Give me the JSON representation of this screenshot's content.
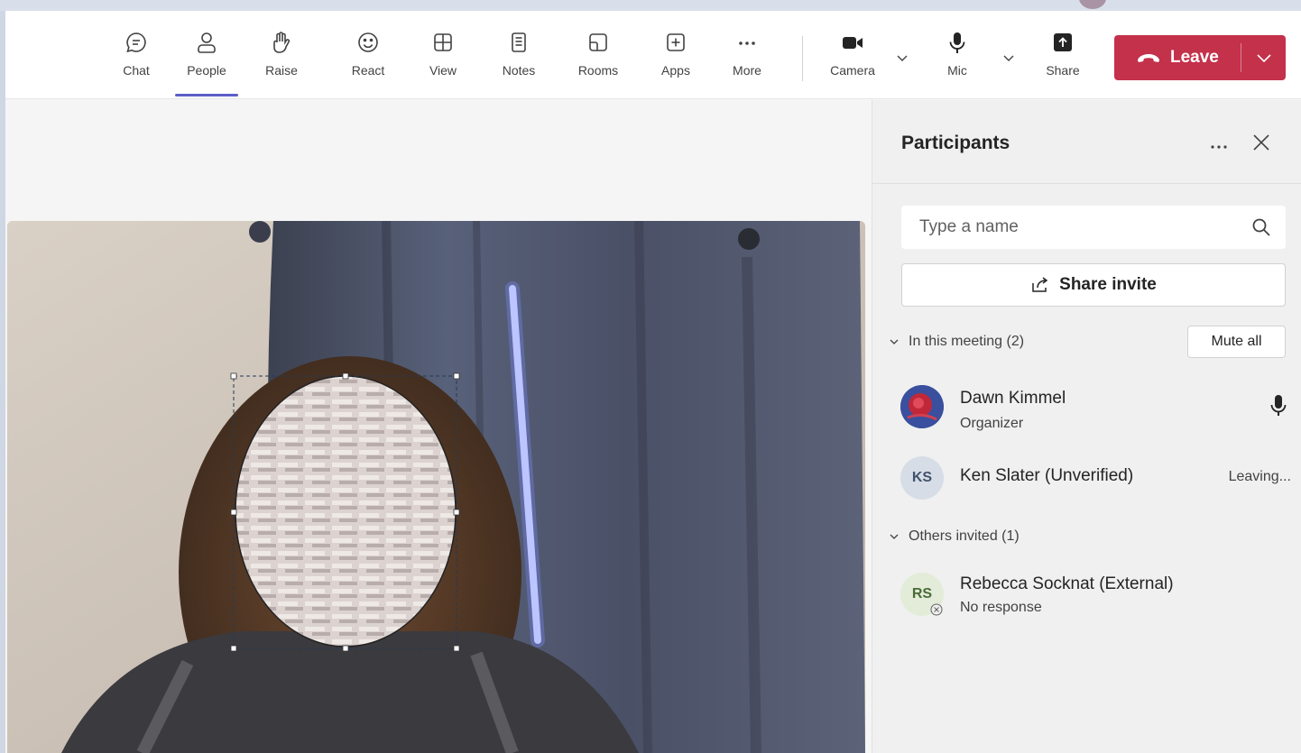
{
  "toolbar": {
    "items": [
      {
        "label": "Chat"
      },
      {
        "label": "People"
      },
      {
        "label": "Raise"
      },
      {
        "label": "React"
      },
      {
        "label": "View"
      },
      {
        "label": "Notes"
      },
      {
        "label": "Rooms"
      },
      {
        "label": "Apps"
      },
      {
        "label": "More"
      }
    ],
    "camera_label": "Camera",
    "mic_label": "Mic",
    "share_label": "Share",
    "leave_label": "Leave",
    "accent": "#5b5fc7",
    "leave_color": "#c4314b"
  },
  "participants": {
    "title": "Participants",
    "search_placeholder": "Type a name",
    "share_invite_label": "Share invite",
    "in_meeting_header": "In this meeting (2)",
    "mute_all_label": "Mute all",
    "others_header": "Others invited (1)",
    "people": [
      {
        "name": "Dawn Kimmel",
        "role": "Organizer",
        "initials": ""
      },
      {
        "name": "Ken Slater (Unverified)",
        "status": "Leaving...",
        "initials": "KS"
      }
    ],
    "invited": [
      {
        "name": "Rebecca Socknat (External)",
        "status": "No response",
        "initials": "RS"
      }
    ]
  }
}
